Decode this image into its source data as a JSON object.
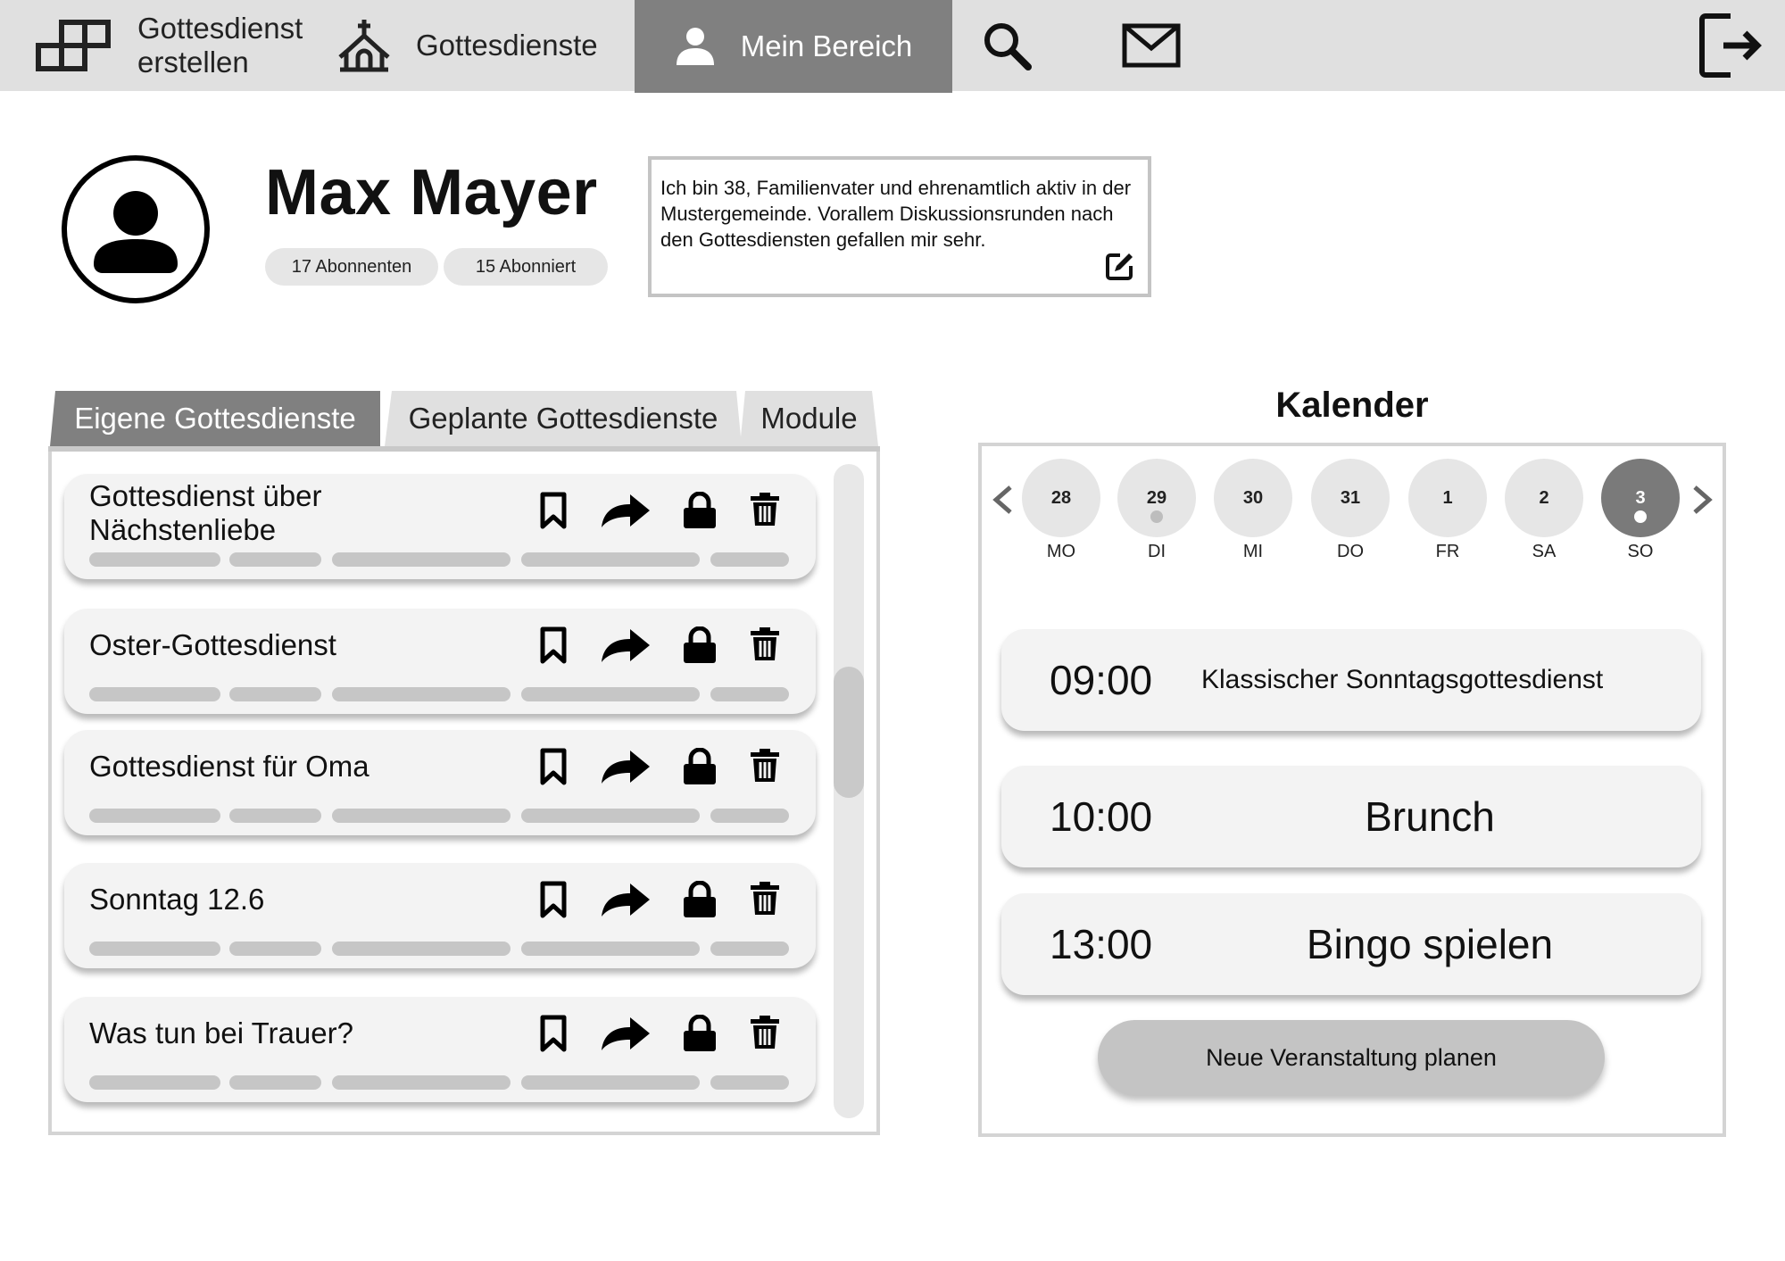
{
  "nav": {
    "create_label": "Gottesdienst erstellen",
    "services_label": "Gottesdienste",
    "mine_label": "Mein Bereich",
    "icons": [
      "blocks-icon",
      "church-icon",
      "user-icon",
      "search-icon",
      "mail-icon",
      "logout-icon"
    ]
  },
  "profile": {
    "name": "Max Mayer",
    "followers": "17 Abonnenten",
    "following": "15 Abonniert",
    "bio": "Ich bin 38, Familienvater und ehrenamtlich aktiv in der Mustergemeinde. Vorallem Diskussionsrunden nach den Gottesdiensten gefallen mir sehr."
  },
  "tabs": [
    {
      "label": "Eigene Gottesdienste",
      "active": true
    },
    {
      "label": "Geplante Gottesdienste",
      "active": false
    },
    {
      "label": "Module",
      "active": false
    }
  ],
  "services": [
    {
      "title": "Gottesdienst über Nächstenliebe"
    },
    {
      "title": "Oster-Gottesdienst"
    },
    {
      "title": "Gottesdienst für Oma"
    },
    {
      "title": "Sonntag 12.6"
    },
    {
      "title": "Was tun bei Trauer?"
    }
  ],
  "calendar": {
    "title": "Kalender",
    "days": [
      {
        "num": "28",
        "name": "MO",
        "dot": false,
        "active": false
      },
      {
        "num": "29",
        "name": "DI",
        "dot": true,
        "active": false
      },
      {
        "num": "30",
        "name": "MI",
        "dot": false,
        "active": false
      },
      {
        "num": "31",
        "name": "DO",
        "dot": false,
        "active": false
      },
      {
        "num": "1",
        "name": "FR",
        "dot": false,
        "active": false
      },
      {
        "num": "2",
        "name": "SA",
        "dot": false,
        "active": false
      },
      {
        "num": "3",
        "name": "SO",
        "dot": true,
        "active": true
      }
    ],
    "events": [
      {
        "time": "09:00",
        "title": "Klassischer Sonntagsgottesdienst"
      },
      {
        "time": "10:00",
        "title": "Brunch"
      },
      {
        "time": "13:00",
        "title": "Bingo spielen"
      }
    ],
    "new_event_label": "Neue Veranstaltung planen"
  },
  "colors": {
    "nav_bg": "#e0e0e0",
    "nav_active": "#808080",
    "card_bg": "#f3f3f3",
    "placeholder_bar": "#c6c6c6",
    "tab_active": "#808080",
    "tab_inactive": "#e0e0e0"
  }
}
